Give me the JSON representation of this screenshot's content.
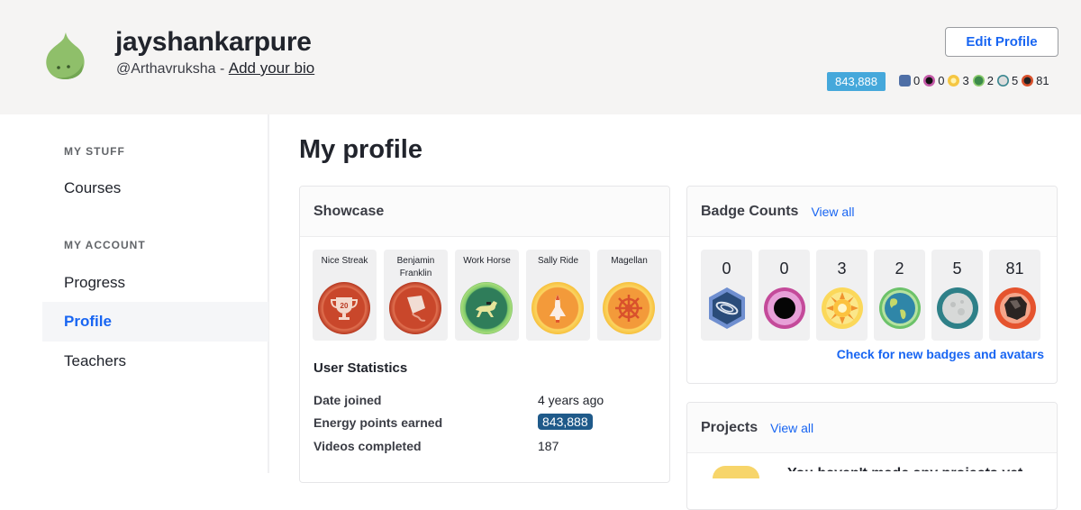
{
  "header": {
    "username": "jayshankarpure",
    "handle": "@Arthavruksha",
    "separator": " - ",
    "bio_link": "Add your bio",
    "edit_profile_label": "Edit Profile",
    "energy_points": "843,888",
    "badge_summary": [
      {
        "icon": "meteorite-badge-icon",
        "count": "0",
        "color": "#4f6fa6"
      },
      {
        "icon": "black-hole-badge-icon",
        "count": "0",
        "color": "#c45aa8"
      },
      {
        "icon": "sun-badge-icon",
        "count": "3",
        "color": "#f5c642"
      },
      {
        "icon": "earth-badge-icon",
        "count": "2",
        "color": "#6dbb5e"
      },
      {
        "icon": "moon-badge-icon",
        "count": "5",
        "color": "#3b8790"
      },
      {
        "icon": "meteorite-rock-badge-icon",
        "count": "81",
        "color": "#d9512c"
      }
    ]
  },
  "sidebar": {
    "sections": [
      {
        "label": "MY STUFF",
        "items": [
          {
            "label": "Courses",
            "active": false
          }
        ]
      },
      {
        "label": "MY ACCOUNT",
        "items": [
          {
            "label": "Progress",
            "active": false
          },
          {
            "label": "Profile",
            "active": true
          },
          {
            "label": "Teachers",
            "active": false
          }
        ]
      }
    ]
  },
  "main": {
    "page_title": "My profile",
    "showcase": {
      "title": "Showcase",
      "badges": [
        {
          "name": "Nice Streak",
          "icon": "trophy-20-icon",
          "color": "#c9472b"
        },
        {
          "name": "Benjamin Franklin",
          "icon": "kite-icon",
          "color": "#c9472b"
        },
        {
          "name": "Work Horse",
          "icon": "horse-icon",
          "color": "#3a8a5a"
        },
        {
          "name": "Sally Ride",
          "icon": "space-shuttle-icon",
          "color": "#f0a030"
        },
        {
          "name": "Magellan",
          "icon": "ship-wheel-icon",
          "color": "#f0a030"
        }
      ]
    },
    "user_statistics": {
      "title": "User Statistics",
      "rows": [
        {
          "label": "Date joined",
          "value": "4 years ago"
        },
        {
          "label": "Energy points earned",
          "value": "843,888"
        },
        {
          "label": "Videos completed",
          "value": "187"
        }
      ]
    },
    "badge_counts": {
      "title": "Badge Counts",
      "view_all": "View all",
      "items": [
        {
          "count": "0",
          "icon": "galaxy-hexagon-badge-icon"
        },
        {
          "count": "0",
          "icon": "black-hole-badge-icon"
        },
        {
          "count": "3",
          "icon": "sun-badge-icon"
        },
        {
          "count": "2",
          "icon": "earth-badge-icon"
        },
        {
          "count": "5",
          "icon": "moon-badge-icon"
        },
        {
          "count": "81",
          "icon": "meteorite-badge-icon"
        }
      ],
      "check_link": "Check for new badges and avatars"
    },
    "projects": {
      "title": "Projects",
      "view_all": "View all",
      "empty_text": "You haven't made any projects yet"
    }
  }
}
